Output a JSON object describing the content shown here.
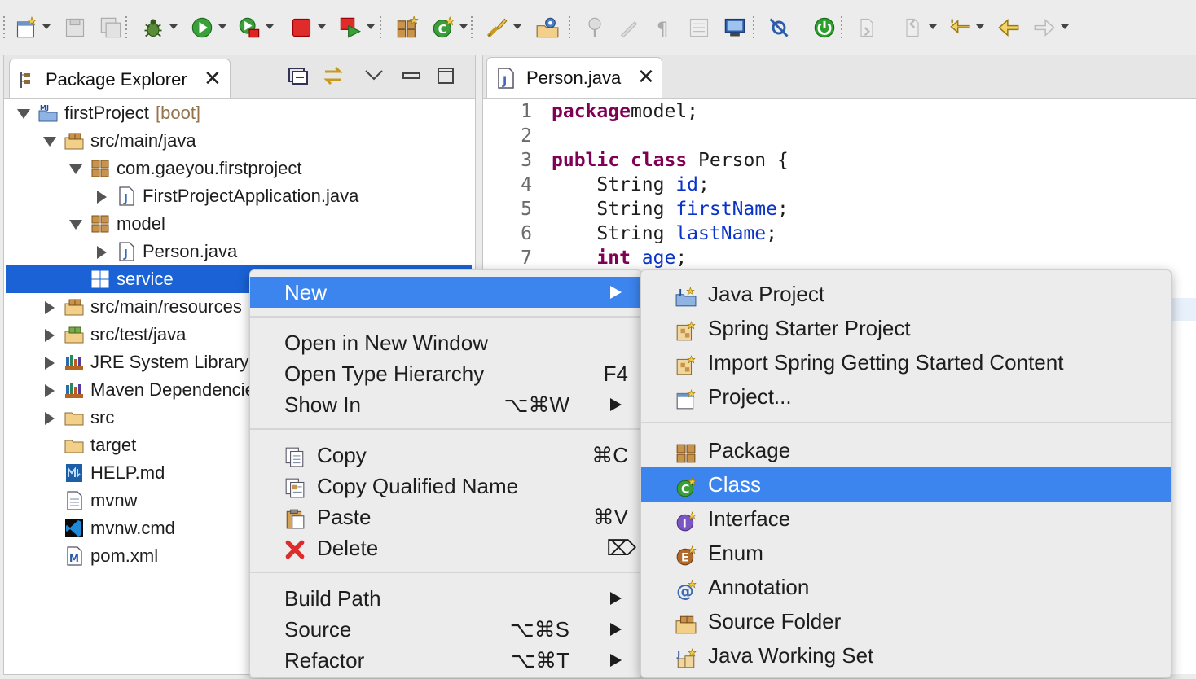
{
  "toolbar": {
    "icons": [
      "new-icon",
      "save-icon",
      "save-all-icon",
      "debug-icon",
      "run-icon",
      "coverage-icon",
      "stop-icon",
      "relaunch-icon",
      "new-java-package-icon",
      "new-java-class-icon",
      "open-task-icon",
      "open-type-icon",
      "pin-icon",
      "toggle-mark-icon",
      "show-whitespace-icon",
      "next-annotation-icon",
      "console-icon",
      "skip-breakpoints-icon",
      "spring-boot-dashboard-icon",
      "next-edit-icon",
      "prev-edit-icon",
      "last-edit-icon",
      "back-icon",
      "forward-icon"
    ]
  },
  "explorer": {
    "title": "Package Explorer",
    "tree": [
      {
        "label": "firstProject",
        "decoration": "[boot]",
        "level": 0,
        "state": "open",
        "icon": "maven-project-icon"
      },
      {
        "label": "src/main/java",
        "level": 1,
        "state": "open",
        "icon": "source-folder-icon"
      },
      {
        "label": "com.gaeyou.firstproject",
        "level": 2,
        "state": "open",
        "icon": "package-icon"
      },
      {
        "label": "FirstProjectApplication.java",
        "level": 3,
        "state": "closed",
        "icon": "java-file-icon"
      },
      {
        "label": "model",
        "level": 2,
        "state": "open",
        "icon": "package-icon"
      },
      {
        "label": "Person.java",
        "level": 3,
        "state": "closed",
        "icon": "java-file-icon"
      },
      {
        "label": "service",
        "level": 2,
        "state": "none",
        "icon": "empty-package-icon",
        "selected": true
      },
      {
        "label": "src/main/resources",
        "level": 1,
        "state": "closed",
        "icon": "source-folder-icon"
      },
      {
        "label": "src/test/java",
        "level": 1,
        "state": "closed",
        "icon": "test-source-folder-icon"
      },
      {
        "label": "JRE System Library",
        "level": 1,
        "state": "closed",
        "icon": "library-icon"
      },
      {
        "label": "Maven Dependencies",
        "level": 1,
        "state": "closed",
        "icon": "library-icon"
      },
      {
        "label": "src",
        "level": 1,
        "state": "closed",
        "icon": "folder-icon"
      },
      {
        "label": "target",
        "level": 1,
        "state": "none",
        "icon": "folder-icon"
      },
      {
        "label": "HELP.md",
        "level": 1,
        "state": "none",
        "icon": "markdown-file-icon"
      },
      {
        "label": "mvnw",
        "level": 1,
        "state": "none",
        "icon": "text-file-icon"
      },
      {
        "label": "mvnw.cmd",
        "level": 1,
        "state": "none",
        "icon": "vscode-file-icon"
      },
      {
        "label": "pom.xml",
        "level": 1,
        "state": "none",
        "icon": "maven-pom-icon"
      }
    ]
  },
  "editor": {
    "tab": "Person.java",
    "lines": [
      {
        "n": "1",
        "parts": [
          [
            "kw",
            "package"
          ],
          [
            "",
            "model;"
          ]
        ]
      },
      {
        "n": "2",
        "parts": []
      },
      {
        "n": "3",
        "parts": [
          [
            "kw",
            "public"
          ],
          [
            "",
            " "
          ],
          [
            "kw",
            "class"
          ],
          [
            "",
            " Person {"
          ]
        ]
      },
      {
        "n": "4",
        "parts": [
          [
            "",
            "    String "
          ],
          [
            "fld",
            "id"
          ],
          [
            "",
            ";"
          ]
        ]
      },
      {
        "n": "5",
        "parts": [
          [
            "",
            "    String "
          ],
          [
            "fld",
            "firstName"
          ],
          [
            "",
            ";"
          ]
        ]
      },
      {
        "n": "6",
        "parts": [
          [
            "",
            "    String "
          ],
          [
            "fld",
            "lastName"
          ],
          [
            "",
            ";"
          ]
        ]
      },
      {
        "n": "7",
        "parts": [
          [
            "",
            "    "
          ],
          [
            "kw",
            "int"
          ],
          [
            "",
            " "
          ],
          [
            "fld",
            "age"
          ],
          [
            "",
            ";"
          ]
        ]
      }
    ]
  },
  "context_menu": {
    "items": [
      {
        "label": "New",
        "submenu": true,
        "highlighted": true
      },
      {
        "sep": true
      },
      {
        "label": "Open in New Window"
      },
      {
        "label": "Open Type Hierarchy",
        "shortcut": "F4"
      },
      {
        "label": "Show In",
        "shortcut": "⌥⌘W",
        "submenu": true
      },
      {
        "sep": true
      },
      {
        "label": "Copy",
        "shortcut": "⌘C",
        "icon": "copy-icon"
      },
      {
        "label": "Copy Qualified Name",
        "icon": "copy-qualified-name-icon"
      },
      {
        "label": "Paste",
        "shortcut": "⌘V",
        "icon": "paste-icon"
      },
      {
        "label": "Delete",
        "shortcut": "⌦",
        "icon": "delete-icon"
      },
      {
        "sep": true
      },
      {
        "label": "Build Path",
        "submenu": true
      },
      {
        "label": "Source",
        "shortcut": "⌥⌘S",
        "submenu": true
      },
      {
        "label": "Refactor",
        "shortcut": "⌥⌘T",
        "submenu": true
      }
    ]
  },
  "new_submenu": {
    "items": [
      {
        "label": "Java Project",
        "icon": "java-project-icon"
      },
      {
        "label": "Spring Starter Project",
        "icon": "spring-starter-project-icon"
      },
      {
        "label": "Import Spring Getting Started Content",
        "icon": "spring-import-icon"
      },
      {
        "label": "Project...",
        "icon": "project-icon"
      },
      {
        "sep": true
      },
      {
        "label": "Package",
        "icon": "package-icon"
      },
      {
        "label": "Class",
        "icon": "class-icon",
        "highlighted": true
      },
      {
        "label": "Interface",
        "icon": "interface-icon"
      },
      {
        "label": "Enum",
        "icon": "enum-icon"
      },
      {
        "label": "Annotation",
        "icon": "annotation-icon"
      },
      {
        "label": "Source Folder",
        "icon": "source-folder-icon"
      },
      {
        "label": "Java Working Set",
        "icon": "java-working-set-icon"
      }
    ]
  },
  "colors": {
    "selection": "#1a62d5",
    "menu_highlight": "#3c84ee",
    "keyword": "#7f0055",
    "field": "#0a33c8"
  }
}
